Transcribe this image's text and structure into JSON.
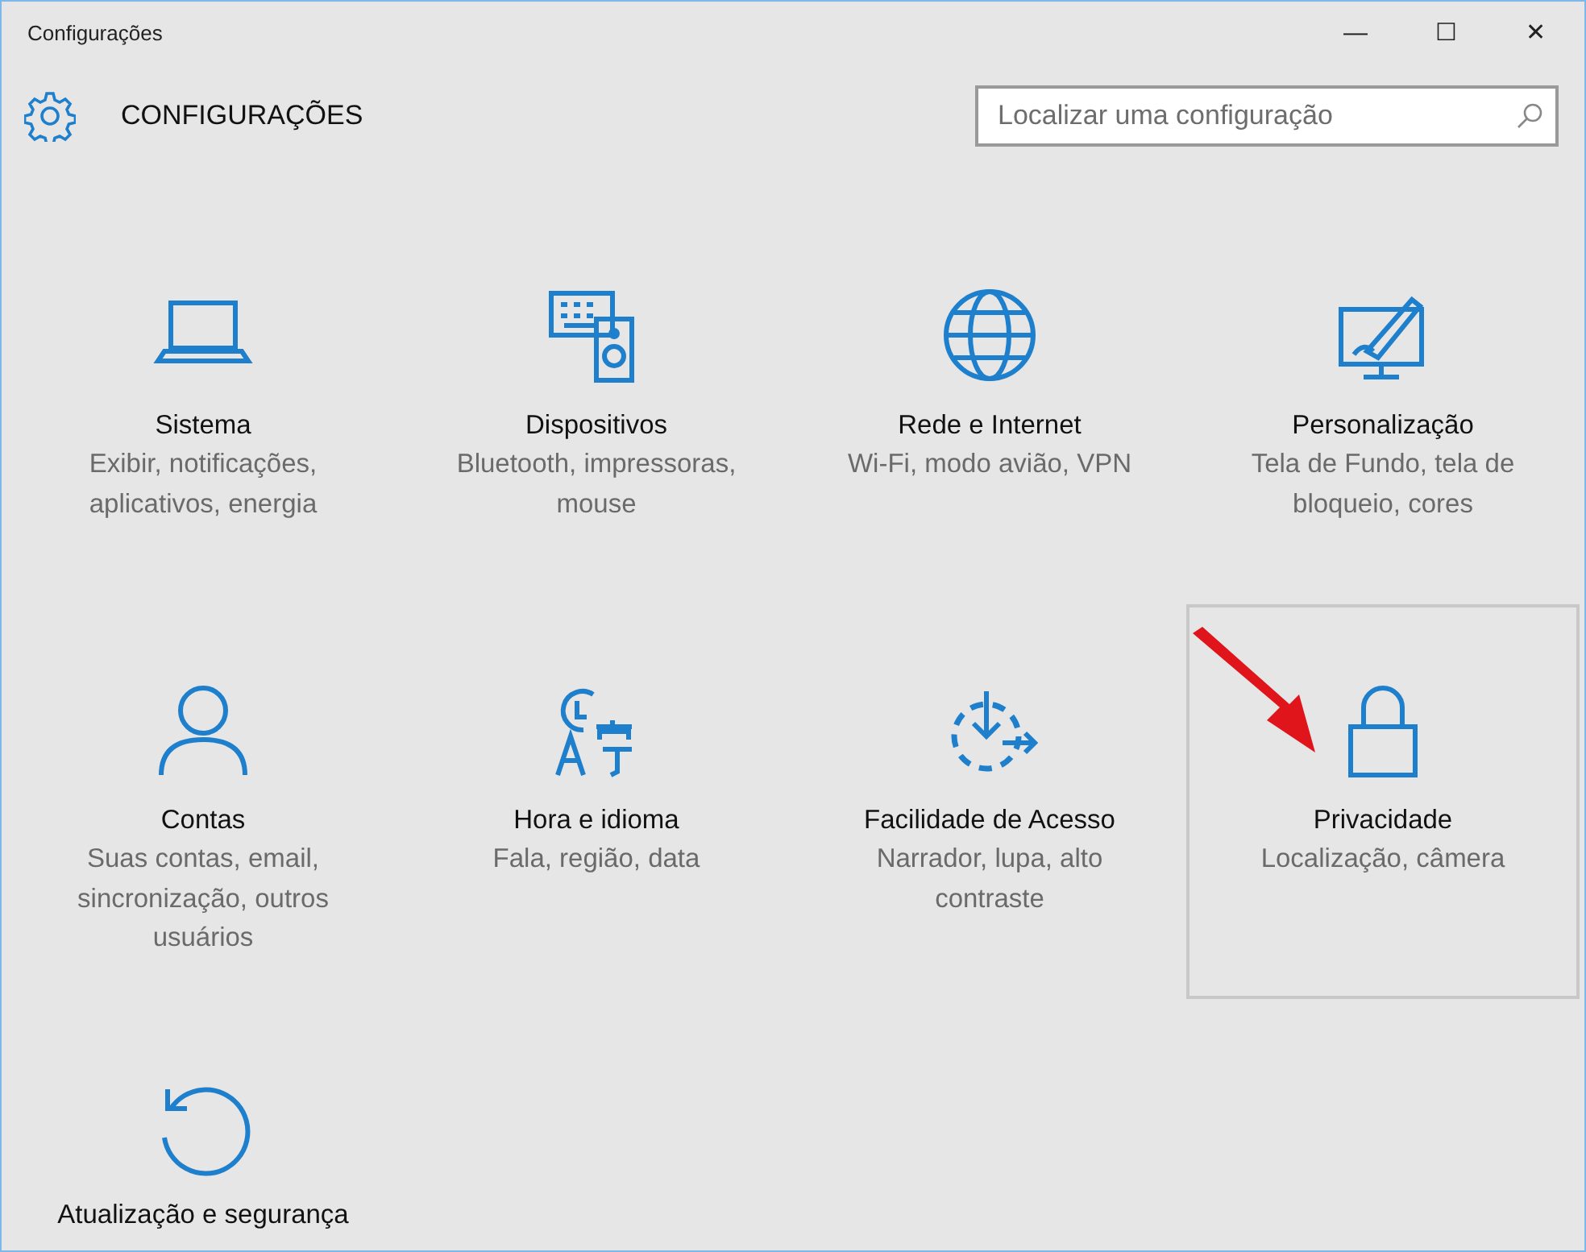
{
  "window": {
    "title": "Configurações",
    "controls": [
      "—",
      "☐",
      "✕"
    ]
  },
  "header": {
    "title": "CONFIGURAÇÕES",
    "search": {
      "placeholder": "Localizar uma configuração"
    }
  },
  "tiles": [
    {
      "name": "Sistema",
      "description": "Exibir, notificações, aplicativos, energia",
      "selected": false
    },
    {
      "name": "Dispositivos",
      "description": "Bluetooth, impressoras, mouse",
      "selected": false
    },
    {
      "name": "Rede e Internet",
      "description": "Wi-Fi, modo avião, VPN",
      "selected": false
    },
    {
      "name": "Personalização",
      "description": "Tela de Fundo, tela de bloqueio, cores",
      "selected": false
    },
    {
      "name": "Contas",
      "description": "Suas contas, email, sincronização, outros usuários",
      "selected": false
    },
    {
      "name": "Hora e idioma",
      "description": "Fala, região, data",
      "selected": false
    },
    {
      "name": "Facilidade de Acesso",
      "description": "Narrador, lupa, alto contraste",
      "selected": false
    },
    {
      "name": "Privacidade",
      "description": "Localização, câmera",
      "selected": true
    },
    {
      "name": "Atualização e segurança",
      "selected": false
    }
  ]
}
